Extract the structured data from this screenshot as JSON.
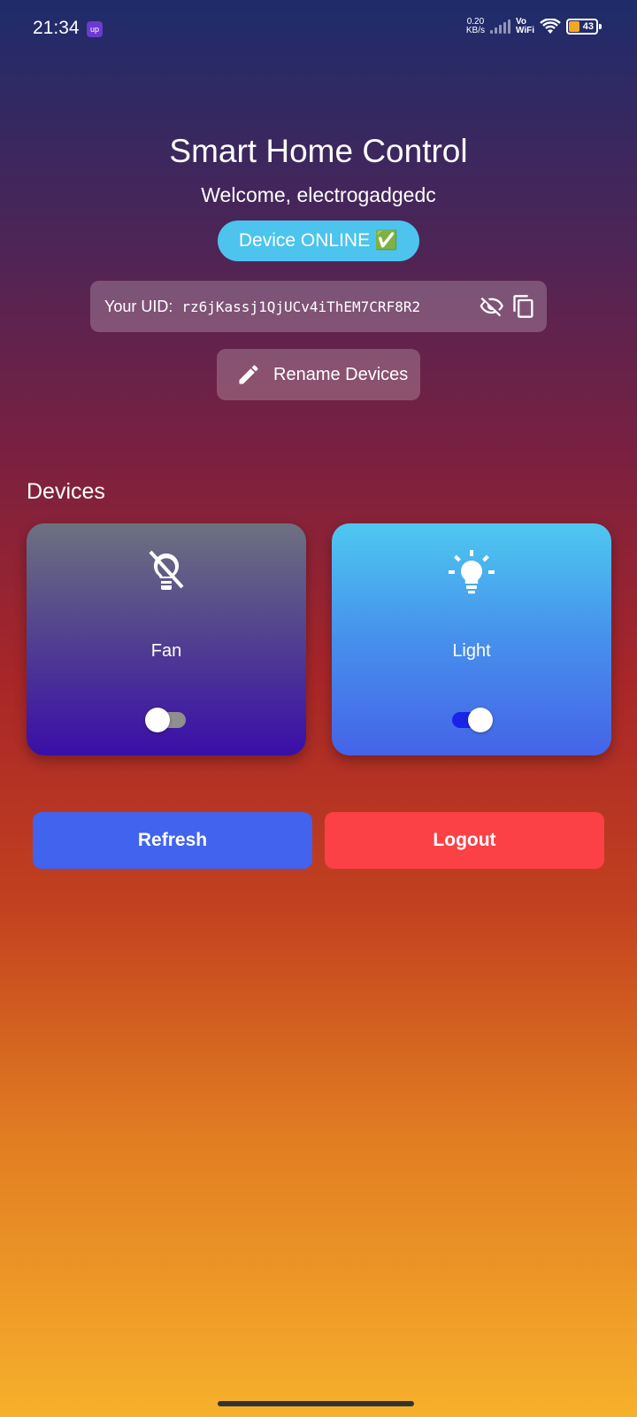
{
  "status_bar": {
    "time": "21:34",
    "app_badge": "up",
    "net_speed_value": "0.20",
    "net_speed_unit": "KB/s",
    "vo": "Vo",
    "wifi": "WiFi",
    "battery": "43"
  },
  "header": {
    "title": "Smart Home Control",
    "welcome": "Welcome, electrogadgedc",
    "status_badge": "Device ONLINE ✅"
  },
  "uid": {
    "label": "Your UID:",
    "value": "rz6jKassj1QjUCv4iThEM7CRF8R2"
  },
  "rename_button": "Rename Devices",
  "devices": {
    "heading": "Devices",
    "items": [
      {
        "name": "Fan",
        "state": "off",
        "icon": "lightbulb-off-icon"
      },
      {
        "name": "Light",
        "state": "on",
        "icon": "lightbulb-on-icon"
      }
    ]
  },
  "actions": {
    "refresh": "Refresh",
    "logout": "Logout"
  },
  "colors": {
    "refresh": "#4163ee",
    "logout": "#fb4146",
    "badge": "#4cc4ee"
  }
}
